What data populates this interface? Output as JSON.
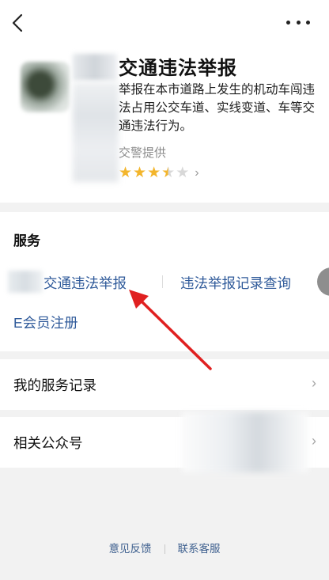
{
  "topbar": {
    "back_icon": "chevron-left-icon",
    "more_icon": "more-dots-icon"
  },
  "app": {
    "title": "交通违法举报",
    "description": "举报在本市道路上发生的机动车闯违法占用公交车道、实线变道、车等交通违法行为。",
    "provider": "交警提供",
    "rating": {
      "stars": 3.5,
      "max": 5
    }
  },
  "services": {
    "heading": "服务",
    "items": [
      {
        "label": "交通违法举报"
      },
      {
        "label": "违法举报记录查询"
      },
      {
        "label": "E会员注册"
      }
    ]
  },
  "rows": {
    "records": {
      "label": "我的服务记录"
    },
    "accounts": {
      "label": "相关公众号"
    }
  },
  "footer": {
    "feedback": "意见反馈",
    "contact": "联系客服"
  },
  "colors": {
    "link": "#2f5a9a",
    "star": "#f3b52b",
    "arrow": "#e02020"
  }
}
